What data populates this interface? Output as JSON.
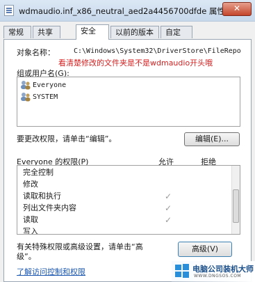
{
  "window": {
    "title": "wdmaudio.inf_x86_neutral_aed2a4456700dfde 属性",
    "close_label": "✕"
  },
  "tabs": [
    {
      "label": "常规"
    },
    {
      "label": "共享"
    },
    {
      "label": "安全"
    },
    {
      "label": "以前的版本"
    },
    {
      "label": "自定义"
    }
  ],
  "security": {
    "object_name_label": "对象名称：",
    "object_name_value": "C:\\Windows\\System32\\DriverStore\\FileRepo",
    "annotation": "看清楚修改的文件夹是不是wdmaudio开头哦",
    "group_label": "组或用户名(G):",
    "users": [
      {
        "name": "Everyone"
      },
      {
        "name": "SYSTEM"
      }
    ],
    "change_hint": "要更改权限，请单击“编辑”。",
    "edit_button": "编辑(E)...",
    "perm_header": "Everyone 的权限(P)",
    "allow_header": "允许",
    "deny_header": "拒绝",
    "permissions": [
      {
        "name": "完全控制",
        "allow": ""
      },
      {
        "name": "修改",
        "allow": ""
      },
      {
        "name": "读取和执行",
        "allow": "✓"
      },
      {
        "name": "列出文件夹内容",
        "allow": "✓"
      },
      {
        "name": "读取",
        "allow": "✓"
      },
      {
        "name": "写入",
        "allow": ""
      }
    ],
    "special_hint_line1": "有关特殊权限或高级设置，请单击“高",
    "special_hint_line2": "级”。",
    "advanced_button": "高级(V)",
    "learn_link": "了解访问控制和权限"
  },
  "watermark": {
    "text": "电脑公司装机大师",
    "url": "WWW.DNGSOS.COM"
  }
}
